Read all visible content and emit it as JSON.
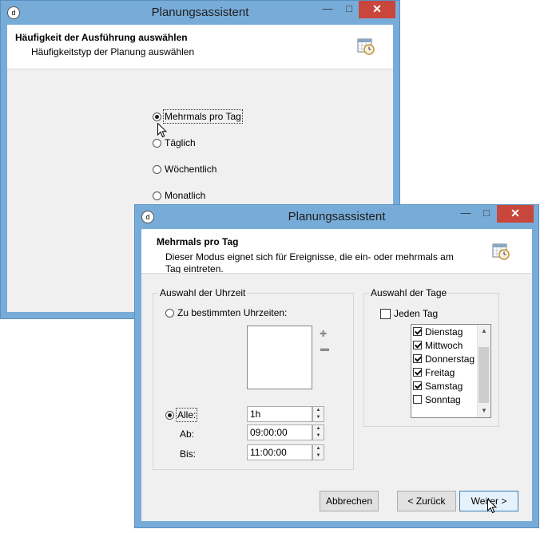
{
  "window1": {
    "title": "Planungsassistent",
    "header_title": "Häufigkeit der Ausführung auswählen",
    "header_subtitle": "Häufigkeitstyp der Planung auswählen",
    "options": [
      {
        "label": "Mehrmals pro Tag",
        "selected": true
      },
      {
        "label": "Täglich",
        "selected": false
      },
      {
        "label": "Wöchentlich",
        "selected": false
      },
      {
        "label": "Monatlich",
        "selected": false
      }
    ]
  },
  "window2": {
    "title": "Planungsassistent",
    "header_title": "Mehrmals pro Tag",
    "header_subtitle_line1": "Dieser Modus eignet sich für Ereignisse, die ein- oder mehrmals am",
    "header_subtitle_line2": "Tag eintreten.",
    "time_group": {
      "legend": "Auswahl der Uhrzeit",
      "specific_times_label": "Zu bestimmten Uhrzeiten:",
      "every_label": "Alle:",
      "every_value": "1h",
      "from_label": "Ab:",
      "from_value": "09:00:00",
      "until_label": "Bis:",
      "until_value": "11:00:00"
    },
    "days_group": {
      "legend": "Auswahl der Tage",
      "every_day_label": "Jeden Tag",
      "days": [
        {
          "label": "Dienstag",
          "checked": true
        },
        {
          "label": "Mittwoch",
          "checked": true
        },
        {
          "label": "Donnerstag",
          "checked": true
        },
        {
          "label": "Freitag",
          "checked": true
        },
        {
          "label": "Samstag",
          "checked": true
        },
        {
          "label": "Sonntag",
          "checked": false
        }
      ]
    },
    "buttons": {
      "cancel": "Abbrechen",
      "back": "< Zurück",
      "next": "Weiter >"
    }
  },
  "colors": {
    "frame": "#78acd8",
    "close": "#c9463d",
    "client": "#f0f0f0"
  },
  "icons": [
    "app-icon",
    "minimize-icon",
    "maximize-icon",
    "close-icon",
    "calendar-clock-icon",
    "add-icon",
    "remove-icon",
    "mouse-cursor-icon"
  ]
}
